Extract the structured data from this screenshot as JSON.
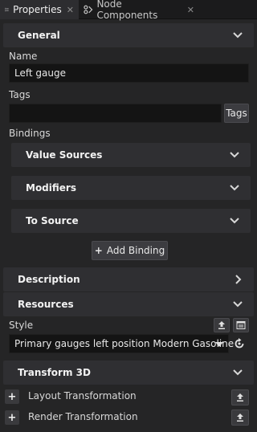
{
  "tabs": [
    {
      "label": "Properties",
      "icon": "properties-icon"
    },
    {
      "label": "Node Components",
      "icon": "node-components-icon"
    }
  ],
  "general": {
    "header": "General",
    "name_label": "Name",
    "name_value": "Left gauge",
    "tags_label": "Tags",
    "tags_value": "",
    "tags_button": "Tags",
    "bindings_label": "Bindings",
    "bindings_groups": [
      "Value Sources",
      "Modifiers",
      "To Source"
    ],
    "add_binding": "Add Binding"
  },
  "description": {
    "header": "Description"
  },
  "resources": {
    "header": "Resources",
    "style_label": "Style",
    "style_value": "Primary gauges left position Modern Gasoline"
  },
  "transform3d": {
    "header": "Transform 3D",
    "items": [
      "Layout Transformation",
      "Render Transformation"
    ]
  }
}
